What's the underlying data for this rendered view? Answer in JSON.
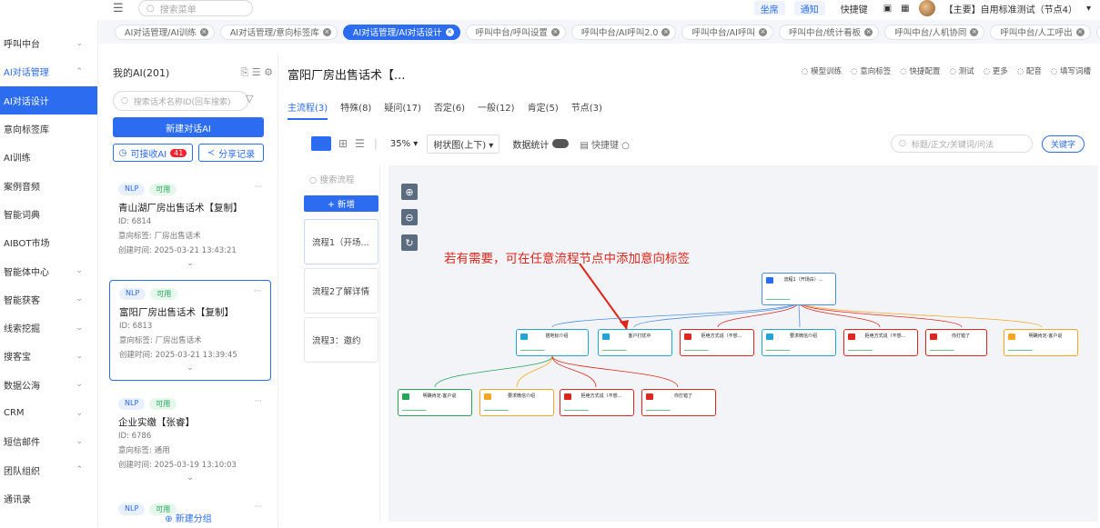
{
  "topbar": {
    "search_placeholder": "搜索菜单",
    "links": [
      "坐席",
      "通知",
      "快捷键"
    ],
    "user": "【主要】自用标准测试（节点4）"
  },
  "sidebar": [
    {
      "label": "呼叫中台",
      "chev": "⌄"
    },
    {
      "label": "AI对话管理",
      "chev": "⌃",
      "state": "active-parent"
    },
    {
      "label": "AI对话设计",
      "state": "active"
    },
    {
      "label": "意向标签库"
    },
    {
      "label": "AI训练"
    },
    {
      "label": "案例音频"
    },
    {
      "label": "智能词典"
    },
    {
      "label": "AIBOT市场"
    },
    {
      "label": "智能体中心",
      "chev": "⌄"
    },
    {
      "label": "智能获客",
      "chev": "⌄"
    },
    {
      "label": "线索挖掘",
      "chev": "⌄"
    },
    {
      "label": "搜客宝",
      "chev": "⌄"
    },
    {
      "label": "数据公海",
      "chev": "⌄"
    },
    {
      "label": "CRM",
      "chev": "⌄"
    },
    {
      "label": "短信邮件",
      "chev": "⌄"
    },
    {
      "label": "团队组织",
      "chev": "⌃"
    },
    {
      "label": "通讯录"
    }
  ],
  "tabs": [
    {
      "label": "AI对话管理/AI训练"
    },
    {
      "label": "AI对话管理/意向标签库"
    },
    {
      "label": "AI对话管理/AI对话设计",
      "active": true
    },
    {
      "label": "呼叫中台/呼叫设置"
    },
    {
      "label": "呼叫中台/AI呼叫2.0"
    },
    {
      "label": "呼叫中台/AI呼叫"
    },
    {
      "label": "呼叫中台/统计看板"
    },
    {
      "label": "呼叫中台/人机协同"
    },
    {
      "label": "呼叫中台/人工呼出"
    },
    {
      "label": "呼叫中台/"
    }
  ],
  "list": {
    "title": "我的AI(201)",
    "search_placeholder": "搜索话术名称ID(回车搜索)",
    "new_button": "新建对话AI",
    "receivable": "可接收AI",
    "receivable_count": "41",
    "share": "分享记录",
    "new_group": "新建分组",
    "cards": [
      {
        "tag1": "NLP",
        "tag2": "可用",
        "name": "青山湖厂房出售话术【复制】",
        "id": "ID: 6814",
        "label": "意向标签: 厂房出售话术",
        "time": "创建时间: 2025-03-21 13:43:21"
      },
      {
        "tag1": "NLP",
        "tag2": "可用",
        "name": "富阳厂房出售话术【复制】",
        "id": "ID: 6813",
        "label": "意向标签: 厂房出售话术",
        "time": "创建时间: 2025-03-21 13:39:45"
      },
      {
        "tag1": "NLP",
        "tag2": "可用",
        "name": "企业实缴【张睿】",
        "id": "ID: 6786",
        "label": "意向标签: 通用",
        "time": "创建时间: 2025-03-19 13:10:03"
      },
      {
        "tag1": "NLP",
        "tag2": "可用"
      }
    ]
  },
  "main": {
    "title": "富阳厂房出售话术【...",
    "actions": [
      "模型训练",
      "意向标签",
      "快捷配置",
      "测试",
      "更多",
      "配音",
      "填写词槽"
    ],
    "subtabs": [
      "主流程(3)",
      "特殊(8)",
      "疑问(17)",
      "否定(6)",
      "一般(12)",
      "肯定(5)",
      "节点(3)"
    ],
    "zoom": "35%",
    "layout": "树状图(上下)",
    "stats": "数据统计",
    "hotkey": "快捷键",
    "canvas_search": "标题/正文/关键词/问法",
    "keyword_btn": "关键字",
    "flow_search": "搜索流程",
    "add_flow": "+ 新增",
    "flows": [
      "流程1（开场...",
      "流程2了解详情",
      "流程3：邀约"
    ],
    "annotation": "若有需要，可在任意流程节点中添加意向标签",
    "nodes": [
      "流程1（开场白）...",
      "搭地标介绍",
      "客户打扰中",
      "拒绝方式说（不想...",
      "要求微信介绍",
      "拒绝方式说（不想...",
      "你打错了",
      "明确肯定-客户说",
      "明确肯定-客户说",
      "要求微信介绍",
      "拒绝方式说（不想...",
      "你打错了"
    ]
  }
}
